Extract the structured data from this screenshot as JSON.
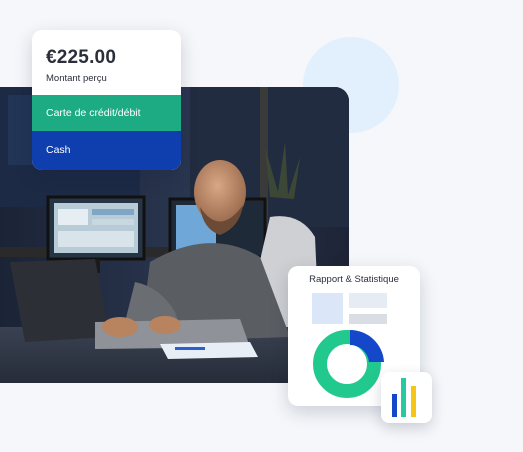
{
  "payment_card": {
    "amount": "€225.00",
    "amount_label": "Montant perçu",
    "options": [
      {
        "label": "Carte de crédit/débit"
      },
      {
        "label": "Cash"
      }
    ]
  },
  "report_card": {
    "title": "Rapport & Statistique"
  },
  "colors": {
    "green": "#1dab84",
    "blue": "#0f3fae",
    "light_blue_circle": "#e2f0fd",
    "donut_green": "#22c98f",
    "donut_blue": "#1447c9",
    "bar_yellow": "#f5c518",
    "bar_teal": "#26c9a0",
    "bar_blue": "#1447c9"
  },
  "icons": {
    "photo": "man-working-at-laptop-photo",
    "donut": "donut-chart-icon",
    "bars": "bar-chart-icon"
  }
}
